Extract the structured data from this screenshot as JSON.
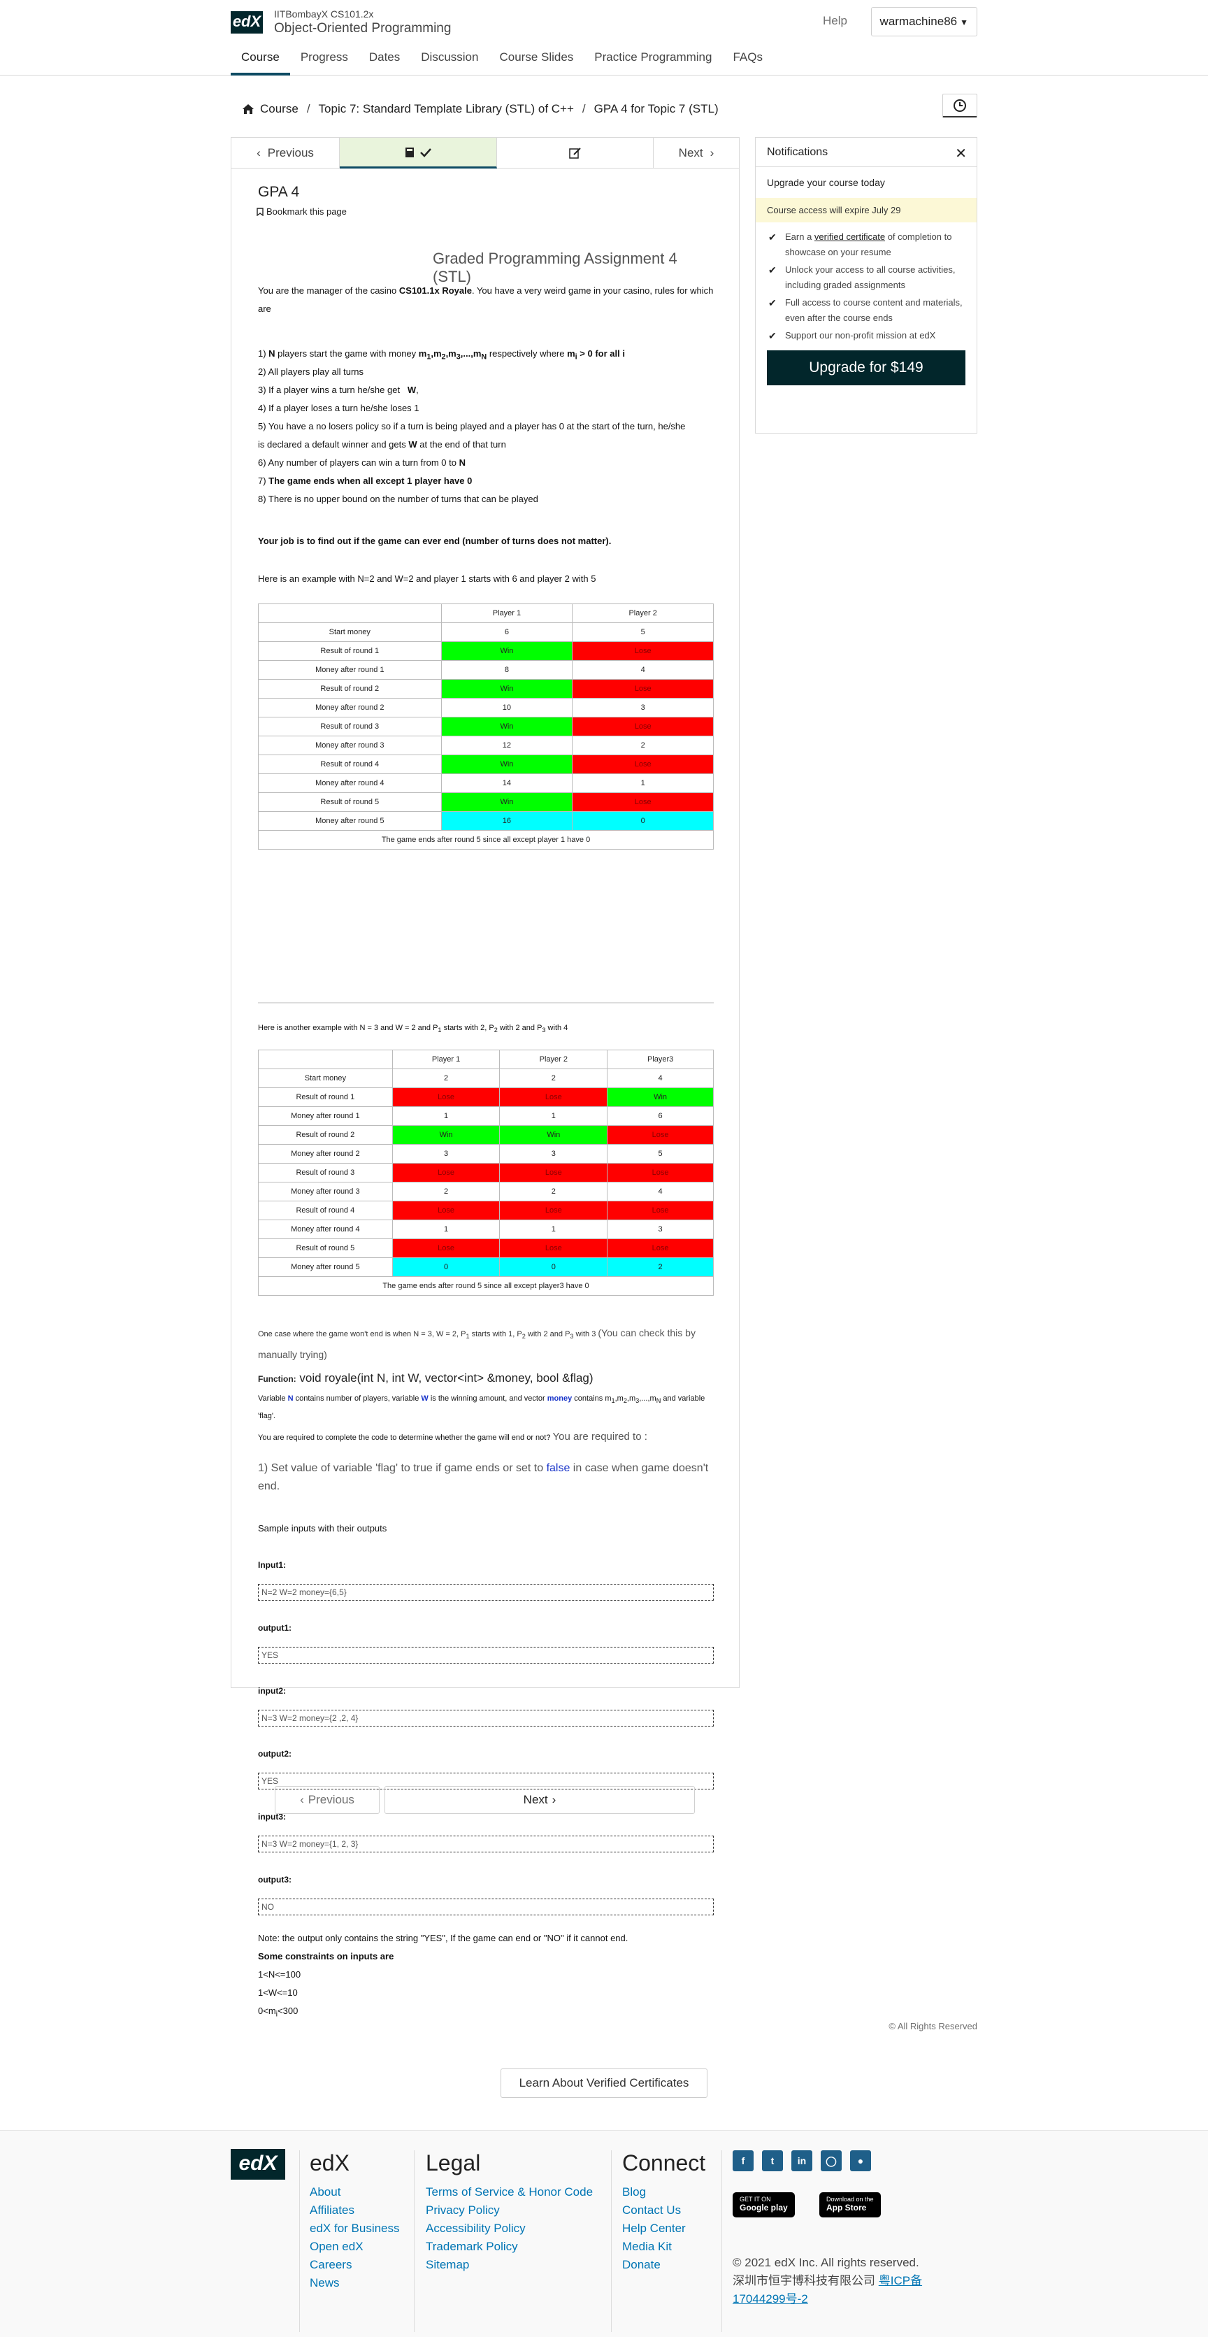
{
  "header": {
    "course_code": "IITBombayX CS101.2x",
    "course_name": "Object-Oriented Programming",
    "help": "Help",
    "username": "warmachine86",
    "logo": "edX",
    "tabs": [
      "Course",
      "Progress",
      "Dates",
      "Discussion",
      "Course Slides",
      "Practice Programming",
      "FAQs"
    ]
  },
  "breadcrumb": {
    "home": "Course",
    "topic": "Topic 7: Standard Template Library (STL) of C++",
    "current": "GPA 4 for Topic 7 (STL)"
  },
  "seq": {
    "prev": "Previous",
    "next": "Next"
  },
  "unit": {
    "title": "GPA 4",
    "bookmark": "Bookmark this page",
    "assign_title": "Graded Programming Assignment 4 (STL)",
    "intro_a": "You are the manager of the casino ",
    "intro_b": "CS101.1x Royale",
    "intro_c": ". You have a very weird game in your casino, rules for which are",
    "rules": [
      "1) N players start the game with money m1,m2,m3,...,mN respectively where mi > 0 for all i",
      "2) All players play all turns",
      "3) If a player wins a turn he/she get   W,",
      "4) If a player loses a turn he/she loses 1",
      "5) You have a no losers policy so if a turn is being played and a player has 0 at the start of the turn, he/she",
      "is declared a default winner and gets W at the end of that turn",
      "6) Any number of players can win a turn from 0 to N",
      "7) The game ends when all except 1 player have 0",
      "8) There is no upper bound on the number of turns that can be played"
    ],
    "job": "Your job is to find out if the game can ever end (number of turns does not matter).",
    "example1_intro": "Here is an example with N=2 and W=2 and player 1 starts with 6 and player 2 with 5",
    "table1": {
      "headers": [
        "",
        "Player 1",
        "Player 2"
      ],
      "rows": [
        [
          "Start money",
          "6",
          "5"
        ],
        [
          "Result of round 1",
          "Win",
          "Lose"
        ],
        [
          "Money after round 1",
          "8",
          "4"
        ],
        [
          "Result of round 2",
          "Win",
          "Lose"
        ],
        [
          "Money after round 2",
          "10",
          "3"
        ],
        [
          "Result of round 3",
          "Win",
          "Lose"
        ],
        [
          "Money after round 3",
          "12",
          "2"
        ],
        [
          "Result of round 4",
          "Win",
          "Lose"
        ],
        [
          "Money after round 4",
          "14",
          "1"
        ],
        [
          "Result of round 5",
          "Win",
          "Lose"
        ],
        [
          "Money after round 5",
          "16",
          "0"
        ]
      ],
      "footer": "The game ends after round 5 since all except player 1 have 0"
    },
    "example2_intro": "Here is another example with N = 3 and W = 2 and P1 starts with 2, P2 with 2 and P3 with 4",
    "table2": {
      "headers": [
        "",
        "Player 1",
        "Player 2",
        "Player3"
      ],
      "rows": [
        [
          "Start money",
          "2",
          "2",
          "4"
        ],
        [
          "Result of round 1",
          "Lose",
          "Lose",
          "Win"
        ],
        [
          "Money after round 1",
          "1",
          "1",
          "6"
        ],
        [
          "Result of round 2",
          "Win",
          "Win",
          "Lose"
        ],
        [
          "Money after round 2",
          "3",
          "3",
          "5"
        ],
        [
          "Result of round 3",
          "Lose",
          "Lose",
          "Lose"
        ],
        [
          "Money after round 3",
          "2",
          "2",
          "4"
        ],
        [
          "Result of round 4",
          "Lose",
          "Lose",
          "Lose"
        ],
        [
          "Money after round 4",
          "1",
          "1",
          "3"
        ],
        [
          "Result of round 5",
          "Lose",
          "Lose",
          "Lose"
        ],
        [
          "Money after round 5",
          "0",
          "0",
          "2"
        ]
      ],
      "footer": "The game ends after round 5 since all except player3 have 0"
    },
    "no_end_case": "One case where the game won't end is when N = 3, W = 2, P1 starts with 1, P2 with 2 and P3 with 3 ",
    "no_end_case_big": "(You can check this by manually trying)",
    "function_label": "Function:",
    "function_sig": "void royale(int N, int W, vector<int> &money, bool &flag)",
    "var_desc": "Variable N contains number of players, variable W is the winning amount, and vector money contains m1,m2,m3,...,mN and variable 'flag'.",
    "required_a": "You are required to complete the code to determine whether the game will end or not? ",
    "required_b": "You are required to :",
    "required_c_a": "1) Set value of variable 'flag' to true if game ends or set to ",
    "required_c_false": "false",
    "required_c_b": " in case when game doesn't end.",
    "samples_title": "Sample inputs with their outputs",
    "samples": [
      {
        "label": "Input1:",
        "value": "N=2 W=2 money={6,5}"
      },
      {
        "label": "output1:",
        "value": "YES"
      },
      {
        "label": "input2:",
        "value": "N=3 W=2 money={2 ,2, 4}"
      },
      {
        "label": "output2:",
        "value": "YES"
      },
      {
        "label": "input3:",
        "value": "N=3 W=2 money={1, 2, 3}"
      },
      {
        "label": "output3:",
        "value": "NO"
      }
    ],
    "note": "Note: the output only contains the string \"YES\", If the game can end or \"NO\" if it cannot end.",
    "constraints_title": "Some constraints on inputs are",
    "constraints": [
      "1<N<=100",
      "1<W<=10",
      "0<mi<300"
    ],
    "bottom_prev": "Previous",
    "bottom_next": "Next"
  },
  "notifications": {
    "title": "Notifications",
    "upgrade_today": "Upgrade your course today",
    "expire": "Course access will expire July 29",
    "items": [
      "Earn a verified certificate of completion to showcase on your resume",
      "Unlock your access to all course activities, including graded assignments",
      "Full access to course content and materials, even after the course ends",
      "Support our non-profit mission at edX"
    ],
    "button": "Upgrade for $149"
  },
  "footer": {
    "rights": "© All Rights Reserved",
    "learn_btn": "Learn About Verified Certificates",
    "logo": "edX",
    "edx_title": "edX",
    "edx_links": [
      "About",
      "Affiliates",
      "edX for Business",
      "Open edX",
      "Careers",
      "News"
    ],
    "legal_title": "Legal",
    "legal_links": [
      "Terms of Service & Honor Code",
      "Privacy Policy",
      "Accessibility Policy",
      "Trademark Policy",
      "Sitemap"
    ],
    "connect_title": "Connect",
    "connect_links": [
      "Blog",
      "Contact Us",
      "Help Center",
      "Media Kit",
      "Donate"
    ],
    "social": [
      "facebook-icon",
      "twitter-icon",
      "linkedin-icon",
      "instagram-icon",
      "reddit-icon"
    ],
    "google_play_small": "GET IT ON",
    "google_play": "Google play",
    "app_store_small": "Download on the",
    "app_store": "App Store",
    "copyright": "© 2021 edX Inc. All rights reserved.",
    "icp_a": "深圳市恒宇博科技有限公司 ",
    "icp_b": "粤ICP备17044299号-2"
  }
}
